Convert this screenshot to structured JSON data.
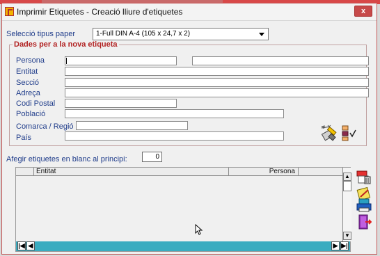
{
  "window": {
    "title": "Imprimir Etiquetes - Creació lliure d'etiquetes",
    "close": "x"
  },
  "paper": {
    "label": "Selecció tipus paper",
    "value": "1-Full DIN A-4 (105 x 24,7 x 2)"
  },
  "group": {
    "title": "Dades per a la nova etiqueta"
  },
  "fields": [
    {
      "label": "Persona",
      "value": ""
    },
    {
      "label": "Entitat",
      "value": ""
    },
    {
      "label": "Secció",
      "value": ""
    },
    {
      "label": "Adreça",
      "value": ""
    },
    {
      "label": "Codi Postal",
      "value": ""
    },
    {
      "label": "Població",
      "value": ""
    },
    {
      "label": "Comarca / Regió",
      "value": ""
    },
    {
      "label": "País",
      "value": ""
    }
  ],
  "blank": {
    "label": "Afegir etiquetes en blanc al principi:",
    "value": "0"
  },
  "grid": {
    "col1": "Entitat",
    "col2": "Persona"
  },
  "icons": {
    "print": "print-labels-icon",
    "select": "select-list-icon",
    "delete": "delete-rows-icon",
    "clear": "clear-icon",
    "printer": "printer-icon",
    "exit": "exit-icon"
  }
}
